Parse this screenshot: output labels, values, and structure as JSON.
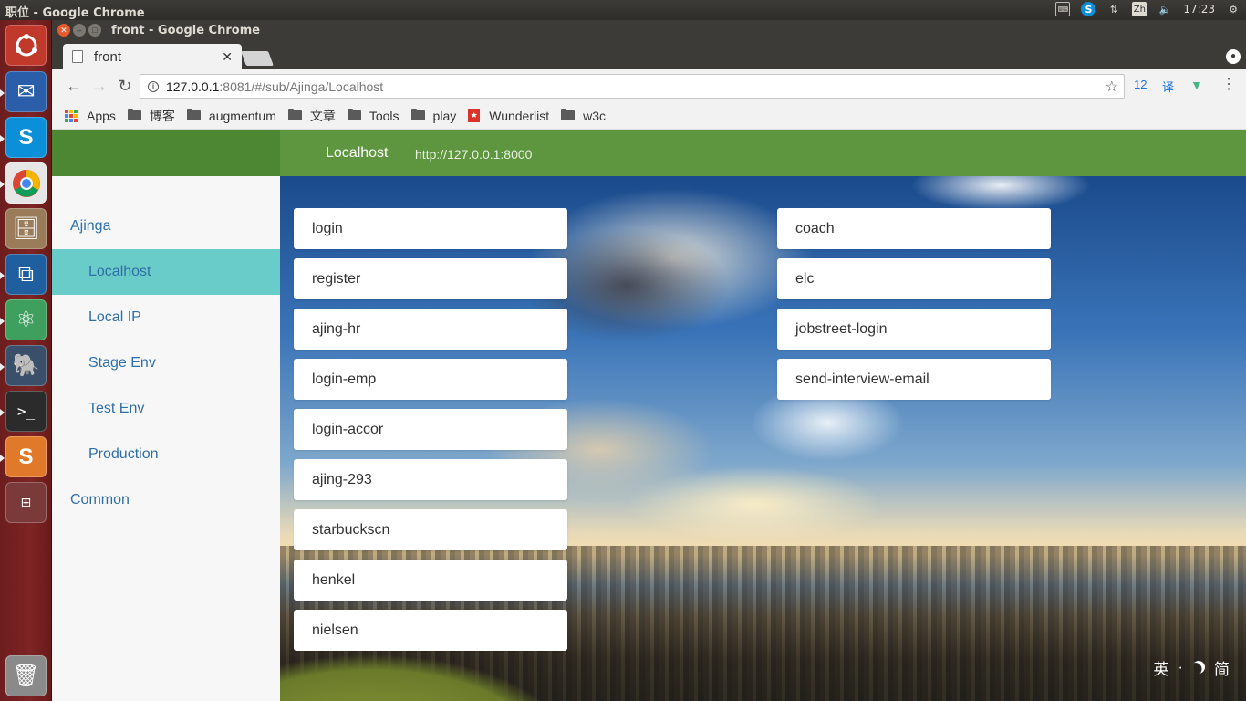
{
  "system": {
    "top_title": "职位 - Google Chrome",
    "clock": "17:23",
    "ime_indicator": "Zh"
  },
  "launcher": {
    "items": [
      {
        "name": "ubuntu-dash",
        "color": "#e05a2a"
      },
      {
        "name": "thunderbird",
        "color": "#2a5ea8"
      },
      {
        "name": "skype",
        "color": "#0a8fd8"
      },
      {
        "name": "chrome",
        "color": "#d8d8d8"
      },
      {
        "name": "files",
        "color": "#9a7b5a"
      },
      {
        "name": "vscode",
        "color": "#1f5f9f"
      },
      {
        "name": "atom",
        "color": "#3f9f5f"
      },
      {
        "name": "pgadmin",
        "color": "#3a4f6a"
      },
      {
        "name": "terminal",
        "color": "#2b2b2b"
      },
      {
        "name": "sublime",
        "color": "#5a5a5a"
      },
      {
        "name": "workspaces",
        "color": "#7a3a3a"
      },
      {
        "name": "trash",
        "color": "#7a7a7a"
      }
    ]
  },
  "window": {
    "title": "front - Google Chrome",
    "tab_title": "front"
  },
  "toolbar": {
    "url_host": "127.0.0.1",
    "url_path": ":8081/#/sub/Ajinga/Localhost",
    "ext_count": "12",
    "ext_translate": "译"
  },
  "bookmarks": {
    "apps_label": "Apps",
    "items": [
      "博客",
      "augmentum",
      "文章",
      "Tools",
      "play",
      "Wunderlist",
      "w3c"
    ]
  },
  "header": {
    "env_name": "Localhost",
    "env_url": "http://127.0.0.1:8000"
  },
  "sidebar": {
    "items": [
      {
        "label": "Ajinga",
        "type": "group"
      },
      {
        "label": "Localhost",
        "type": "sub",
        "active": true
      },
      {
        "label": "Local IP",
        "type": "sub"
      },
      {
        "label": "Stage Env",
        "type": "sub"
      },
      {
        "label": "Test Env",
        "type": "sub"
      },
      {
        "label": "Production",
        "type": "sub"
      },
      {
        "label": "Common",
        "type": "group"
      }
    ]
  },
  "links": {
    "left": [
      "login",
      "register",
      "ajing-hr",
      "login-emp",
      "login-accor",
      "ajing-293",
      "starbuckscn",
      "henkel",
      "nielsen"
    ],
    "right": [
      "coach",
      "elc",
      "jobstreet-login",
      "send-interview-email"
    ]
  },
  "ime": {
    "mode": "英",
    "dot": "·",
    "script": "简"
  },
  "colors": {
    "header_green": "#5d963f",
    "sidebar_active": "#6accc8",
    "link_blue": "#2f6fa8"
  }
}
